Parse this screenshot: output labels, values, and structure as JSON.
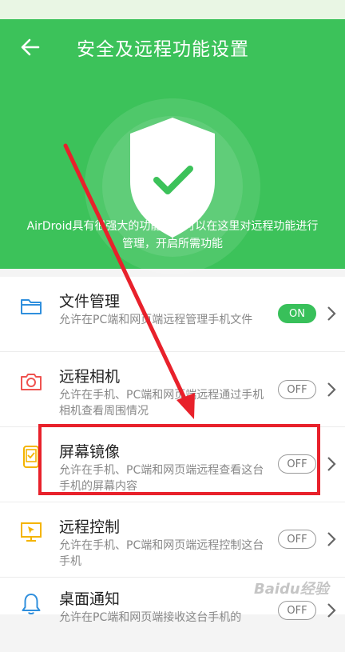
{
  "header": {
    "title": "安全及远程功能设置",
    "back_icon": "back-arrow-icon",
    "shield_icon": "shield-check-icon",
    "intro": "AirDroid具有很强大的功能，您可以在这里对远程功能进行管理，开启所需功能",
    "color": "#3cc25a"
  },
  "features": [
    {
      "name": "文件管理",
      "desc": "允许在PC端和网页端远程管理手机文件",
      "toggle": "ON",
      "icon": "folder-icon",
      "color": "#2f8fdd"
    },
    {
      "name": "远程相机",
      "desc": "允许在手机、PC端和网页端远程通过手机相机查看周围情况",
      "toggle": "OFF",
      "icon": "camera-icon",
      "color": "#ef5350"
    },
    {
      "name": "屏幕镜像",
      "desc": "允许在手机、PC端和网页端远程查看这台手机的屏幕内容",
      "toggle": "OFF",
      "icon": "phone-mirror-icon",
      "color": "#f4b400"
    },
    {
      "name": "远程控制",
      "desc": "允许在手机、PC端和网页端远程控制这台手机",
      "toggle": "OFF",
      "icon": "monitor-cursor-icon",
      "color": "#f4b400"
    },
    {
      "name": "桌面通知",
      "desc": "允许在PC端和网页端接收这台手机的",
      "toggle": "OFF",
      "icon": "bell-icon",
      "color": "#2f8fdd"
    }
  ],
  "annotation": {
    "highlight_color": "#e8212b"
  },
  "watermark": "Baidu经验"
}
